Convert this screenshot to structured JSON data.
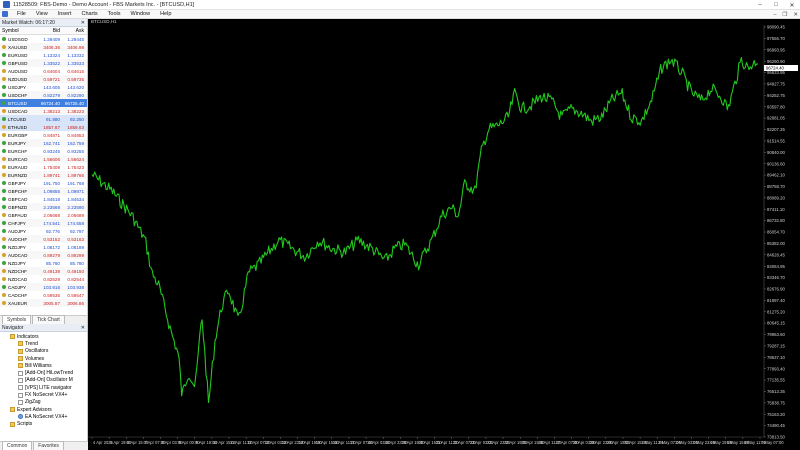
{
  "window": {
    "title": "11528509: FBS-Demo - Demo Account - FBS Markets Inc. - [BTCUSD,H1]"
  },
  "menu": {
    "items": [
      "File",
      "View",
      "Insert",
      "Charts",
      "Tools",
      "Window",
      "Help"
    ]
  },
  "market_watch": {
    "title": "Market Watch: 06:17:20",
    "columns": [
      "Symbol",
      "Bid",
      "Ask"
    ],
    "rows": [
      {
        "symbol": "USDSGD",
        "bid": "1.29409",
        "ask": "1.29445",
        "dir": "up"
      },
      {
        "symbol": "XAUUSD",
        "bid": "3406.36",
        "ask": "3406.98",
        "dir": "dn"
      },
      {
        "symbol": "EURUSD",
        "bid": "1.13324",
        "ask": "1.13332",
        "dir": "up"
      },
      {
        "symbol": "GBPUSD",
        "bid": "1.33522",
        "ask": "1.33533",
        "dir": "up"
      },
      {
        "symbol": "AUDUSD",
        "bid": "0.64604",
        "ask": "0.64615",
        "dir": "dn"
      },
      {
        "symbol": "NZDUSD",
        "bid": "0.59721",
        "ask": "0.59735",
        "dir": "dn"
      },
      {
        "symbol": "USDJPY",
        "bid": "143.605",
        "ask": "143.620",
        "dir": "up"
      },
      {
        "symbol": "USDCHF",
        "bid": "0.82279",
        "ask": "0.82290",
        "dir": "up"
      },
      {
        "symbol": "BTCUSD",
        "bid": "96724.40",
        "ask": "96725.40",
        "dir": "up",
        "selected": true
      },
      {
        "symbol": "USDCAD",
        "bid": "1.38213",
        "ask": "1.38223",
        "dir": "dn"
      },
      {
        "symbol": "LTCUSD",
        "bid": "91.880",
        "ask": "92.250",
        "dir": "up",
        "highlight": true
      },
      {
        "symbol": "ETHUSD",
        "bid": "1857.67",
        "ask": "1859.63",
        "dir": "dn",
        "highlight": true
      },
      {
        "symbol": "EURGBP",
        "bid": "0.84871",
        "ask": "0.84853",
        "dir": "dn"
      },
      {
        "symbol": "EURJPY",
        "bid": "162.741",
        "ask": "162.759",
        "dir": "up"
      },
      {
        "symbol": "EURCHF",
        "bid": "0.93245",
        "ask": "0.93255",
        "dir": "up"
      },
      {
        "symbol": "EURCAD",
        "bid": "1.56606",
        "ask": "1.56624",
        "dir": "dn"
      },
      {
        "symbol": "EURAUD",
        "bid": "1.75409",
        "ask": "1.75423",
        "dir": "dn"
      },
      {
        "symbol": "EURNZD",
        "bid": "1.89741",
        "ask": "1.89766",
        "dir": "dn"
      },
      {
        "symbol": "GBPJPY",
        "bid": "191.750",
        "ask": "191.768",
        "dir": "up"
      },
      {
        "symbol": "GBPCHF",
        "bid": "1.09855",
        "ask": "1.09871",
        "dir": "up"
      },
      {
        "symbol": "GBPCAD",
        "bid": "1.84518",
        "ask": "1.84534",
        "dir": "up"
      },
      {
        "symbol": "GBPNZD",
        "bid": "2.23568",
        "ask": "2.23590",
        "dir": "up"
      },
      {
        "symbol": "GBPAUD",
        "bid": "2.06668",
        "ask": "2.06689",
        "dir": "dn"
      },
      {
        "symbol": "CHFJPY",
        "bid": "174.541",
        "ask": "174.558",
        "dir": "up"
      },
      {
        "symbol": "AUDJPY",
        "bid": "92.776",
        "ask": "92.797",
        "dir": "up"
      },
      {
        "symbol": "AUDCHF",
        "bid": "0.53152",
        "ask": "0.53163",
        "dir": "dn"
      },
      {
        "symbol": "NZDJPY",
        "bid": "1.08172",
        "ask": "1.08189",
        "dir": "up"
      },
      {
        "symbol": "AUDCAD",
        "bid": "0.89279",
        "ask": "0.89299",
        "dir": "dn"
      },
      {
        "symbol": "NZDJPY",
        "bid": "85.760",
        "ask": "85.780",
        "dir": "up"
      },
      {
        "symbol": "NZDCHF",
        "bid": "0.49138",
        "ask": "0.49150",
        "dir": "dn"
      },
      {
        "symbol": "NZDCAD",
        "bid": "0.82529",
        "ask": "0.82544",
        "dir": "dn"
      },
      {
        "symbol": "CADJPY",
        "bid": "103.916",
        "ask": "103.938",
        "dir": "up"
      },
      {
        "symbol": "CADCHF",
        "bid": "0.59535",
        "ask": "0.59547",
        "dir": "dn"
      },
      {
        "symbol": "XAUEUR",
        "bid": "3005.87",
        "ask": "3006.86",
        "dir": "dn"
      }
    ],
    "tabs": [
      "Symbols",
      "Tick Chart"
    ]
  },
  "navigator": {
    "title": "Navigator",
    "items": [
      {
        "label": "Indicators",
        "depth": 1,
        "icon": "folder"
      },
      {
        "label": "Trend",
        "depth": 2,
        "icon": "folder"
      },
      {
        "label": "Oscillators",
        "depth": 2,
        "icon": "folder"
      },
      {
        "label": "Volumes",
        "depth": 2,
        "icon": "folder"
      },
      {
        "label": "Bill Williams",
        "depth": 2,
        "icon": "folder"
      },
      {
        "label": "[Add-On] HiLowTrend",
        "depth": 2,
        "icon": "ind"
      },
      {
        "label": "[Add-On] Oscillator M",
        "depth": 2,
        "icon": "ind"
      },
      {
        "label": "[VPS] LITE navigator",
        "depth": 2,
        "icon": "ind"
      },
      {
        "label": "FX NoSecret VX4+",
        "depth": 2,
        "icon": "ind"
      },
      {
        "label": "ZigZag",
        "depth": 2,
        "icon": "ind"
      },
      {
        "label": "Expert Advisors",
        "depth": 1,
        "icon": "folder"
      },
      {
        "label": "EA NoSecret VX4+",
        "depth": 2,
        "icon": "ea"
      },
      {
        "label": "Scripts",
        "depth": 1,
        "icon": "folder"
      }
    ],
    "tabs": [
      "Common",
      "Favorites"
    ]
  },
  "chart": {
    "title": "BTCUSD,H1",
    "line_color": "#22c81e",
    "bg_color": "#000000",
    "current_price": "96724.40",
    "price_labels": [
      "98090.45",
      "97556.70",
      "96993.95",
      "96290.90",
      "95633.95",
      "94927.75",
      "94252.75",
      "93597.80",
      "92881.05",
      "92207.25",
      "91514.55",
      "90840.00",
      "90136.60",
      "89462.10",
      "88758.70",
      "88089.20",
      "87411.10",
      "86732.80",
      "86054.70",
      "85382.00",
      "84628.45",
      "84064.95",
      "83346.70",
      "82676.90",
      "81997.40",
      "81275.20",
      "80645.15",
      "79963.60",
      "79287.15",
      "78637.10",
      "77893.40",
      "77135.55",
      "76513.35",
      "75838.75",
      "75163.20",
      "74490.45",
      "73813.50"
    ],
    "time_labels": [
      "4 Apr 2025",
      "5 Apr 19:00",
      "6 Apr 15:00",
      "7 Apr 07:00",
      "8 Apr 03:00",
      "9 Apr 00:00",
      "9 Apr 19:00",
      "10 Apr 15:00",
      "11 Apr 11:00",
      "12 Apr 07:00",
      "13 Apr 03:00",
      "13 Apr 23:00",
      "14 Apr 19:00",
      "15 Apr 15:00",
      "16 Apr 11:00",
      "17 Apr 07:00",
      "18 Apr 03:00",
      "18 Apr 23:00",
      "19 Apr 19:00",
      "20 Apr 15:00",
      "21 Apr 11:00",
      "22 Apr 07:00",
      "23 Apr 03:00",
      "23 Apr 23:00",
      "24 Apr 19:00",
      "25 Apr 15:00",
      "26 Apr 11:00",
      "27 Apr 07:00",
      "28 Apr 03:00",
      "28 Apr 23:00",
      "29 Apr 19:00",
      "30 Apr 15:00",
      "1 May 11:00",
      "2 May 07:00",
      "3 May 03:00",
      "3 May 23:00",
      "4 May 19:00",
      "5 May 15:00",
      "6 May 11:00",
      "7 May 07:00"
    ]
  }
}
